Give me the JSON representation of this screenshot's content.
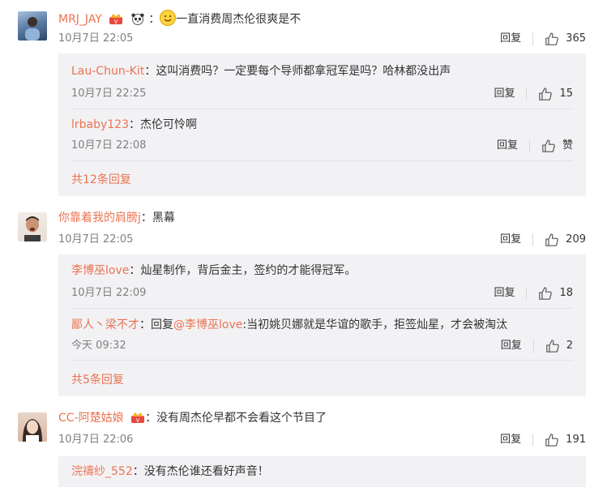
{
  "colors": {
    "name": "#eb7350",
    "meta": "#808080",
    "sub_bg": "#f2f2f5"
  },
  "icons": {
    "like": "thumb-up-icon",
    "vip": "crown-badge-icon",
    "panda": "panda-badge-icon",
    "smile": "smile-emoji-icon"
  },
  "comments": [
    {
      "user": "MRJ_JAY",
      "sep": "：",
      "text": "一直消费周杰伦很爽是不",
      "time": "10月7日 22:05",
      "reply": "回复",
      "likes": "365",
      "replies": [
        {
          "user": "Lau-Chun-Kit",
          "sep": "：",
          "text": "这叫消费吗？一定要每个导师都拿冠军是吗？哈林都没出声",
          "time": "10月7日 22:25",
          "reply": "回复",
          "likes": "15"
        },
        {
          "user": "lrbaby123",
          "sep": "：",
          "text": "杰伦可怜啊",
          "time": "10月7日 22:08",
          "reply": "回复",
          "likes": "赞"
        }
      ],
      "more": "共12条回复"
    },
    {
      "user": "你靠着我的肩膀j",
      "sep": "：",
      "text": "黑幕",
      "time": "10月7日 22:05",
      "reply": "回复",
      "likes": "209",
      "replies": [
        {
          "user": "李博巫love",
          "sep": "：",
          "text": "灿星制作，背后金主，签约的才能得冠军。",
          "time": "10月7日 22:09",
          "reply": "回复",
          "likes": "18"
        },
        {
          "user": "鄙人丶梁不才",
          "sep": "：",
          "reply_prefix": "回复",
          "mention": "@李博巫love",
          "text": ":当初姚贝娜就是华谊的歌手，拒签灿星，才会被淘汰",
          "time": "今天 09:32",
          "reply": "回复",
          "likes": "2"
        }
      ],
      "more": "共5条回复"
    },
    {
      "user": "CC-阿楚姑娘",
      "sep": "：",
      "text": "没有周杰伦早都不会看这个节目了",
      "time": "10月7日 22:06",
      "reply": "回复",
      "likes": "191",
      "replies": [
        {
          "user": "浣禱纱_552",
          "sep": "：",
          "text": "没有杰伦谁还看好声音！"
        }
      ]
    }
  ]
}
